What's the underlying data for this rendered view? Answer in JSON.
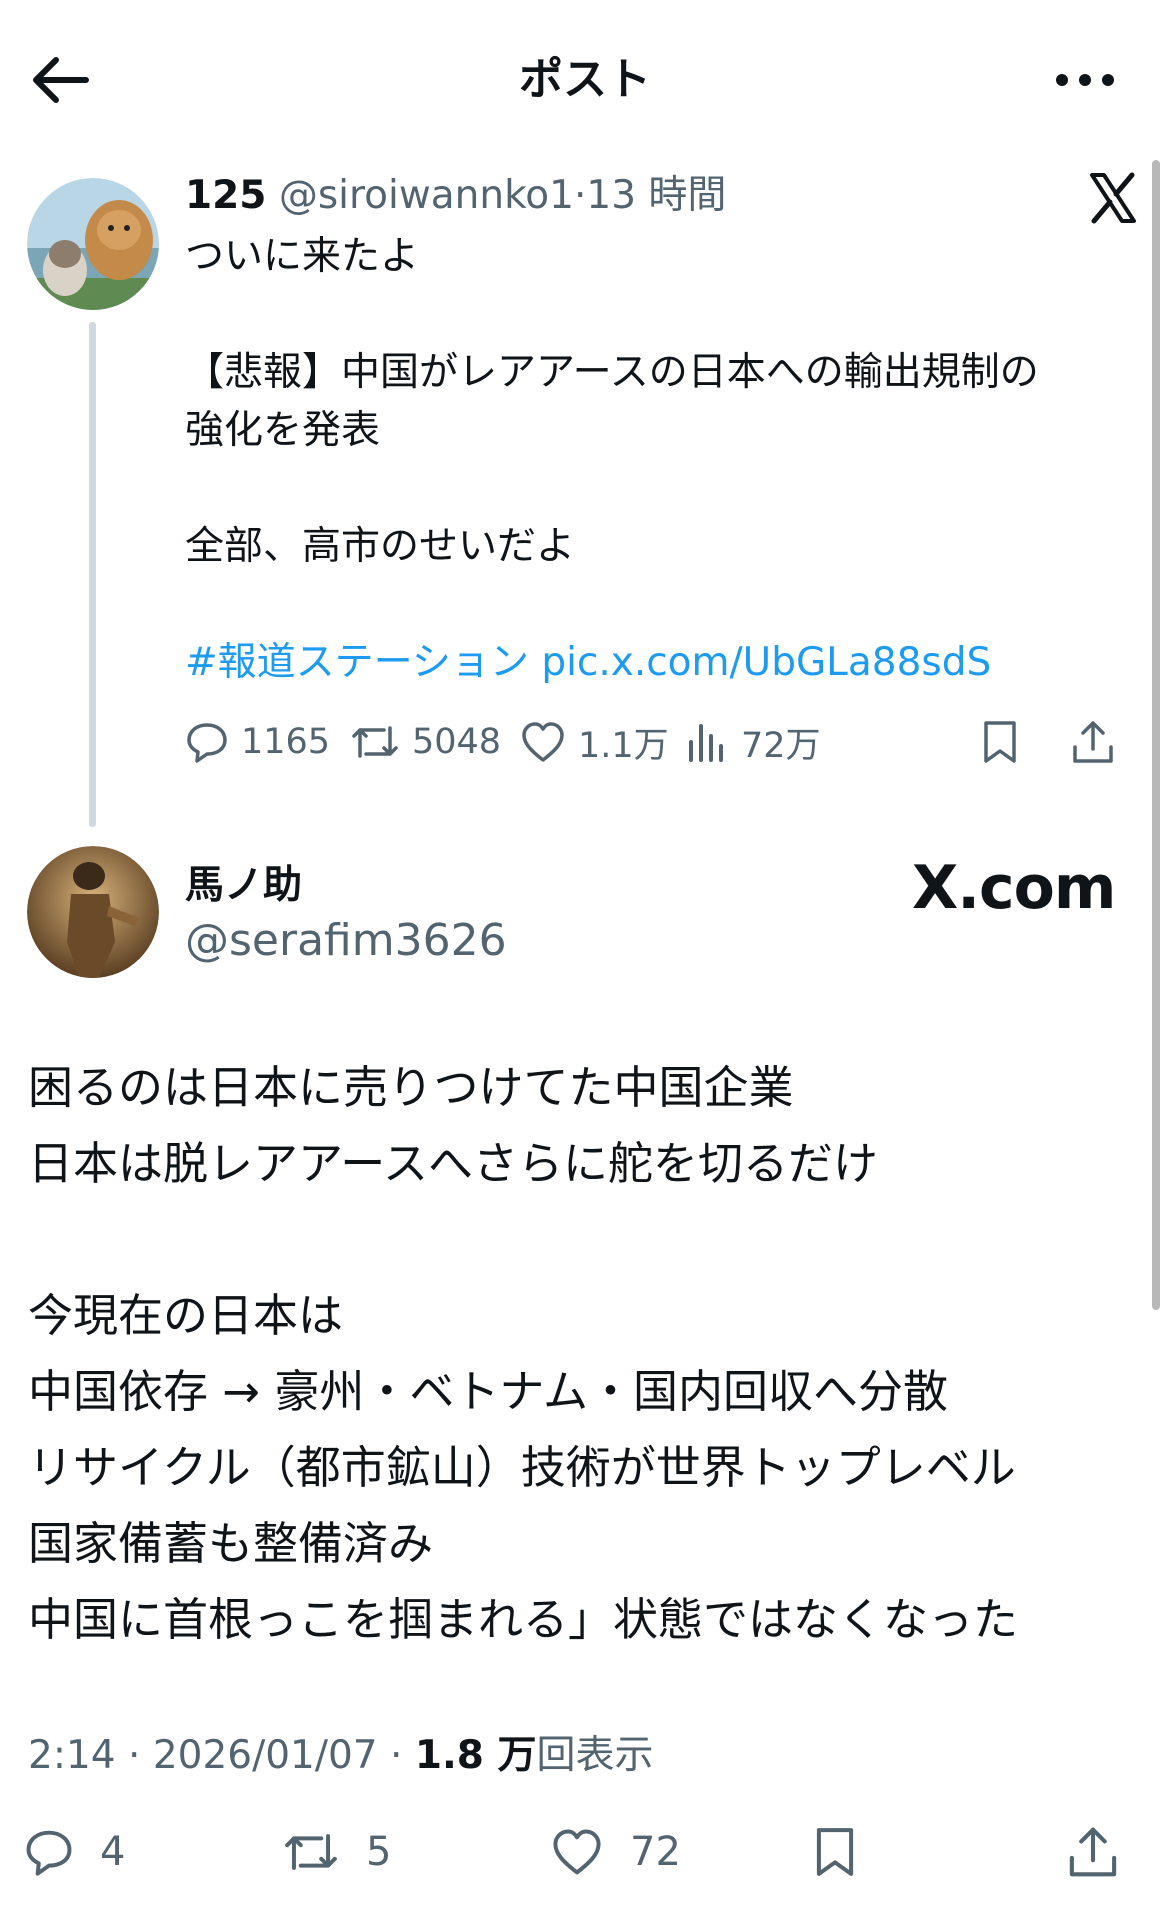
{
  "header": {
    "title": "ポスト"
  },
  "quoted_post": {
    "name": "125",
    "handle": "@siroiwannko1",
    "separator": "·",
    "time": "13 時間",
    "lines": [
      "ついに来たよ",
      "",
      "【悲報】中国がレアアースの日本への輸出規制の",
      "強化を発表",
      "",
      "全部、高市のせいだよ",
      ""
    ],
    "hashtag": "#報道ステーション",
    "link": "pic.x.com/UbGLa88sdS",
    "stats": {
      "replies": "1165",
      "reposts": "5048",
      "likes": "1.1万",
      "views": "72万"
    }
  },
  "author": {
    "name": "馬ノ助",
    "handle": "@serafim3626",
    "watermark": "X.com"
  },
  "post_lines": [
    "困るのは日本に売りつけてた中国企業",
    "日本は脱レアアースへさらに舵を切るだけ",
    "",
    "今現在の日本は",
    "中国依存 → 豪州・ベトナム・国内回収へ分散",
    "リサイクル（都市鉱山）技術が世界トップレベル",
    "国家備蓄も整備済み",
    "中国に首根っこを掴まれる」状態ではなくなった"
  ],
  "meta": {
    "time": "2:14",
    "dot": "·",
    "date": "2026/01/07",
    "views_count": "1.8 万",
    "views_label": "回表示"
  },
  "post_stats": {
    "replies": "4",
    "reposts": "5",
    "likes": "72"
  },
  "colors": {
    "link": "#1d9bf0",
    "secondary_text": "#536471",
    "thread_line": "#cfd9de"
  }
}
